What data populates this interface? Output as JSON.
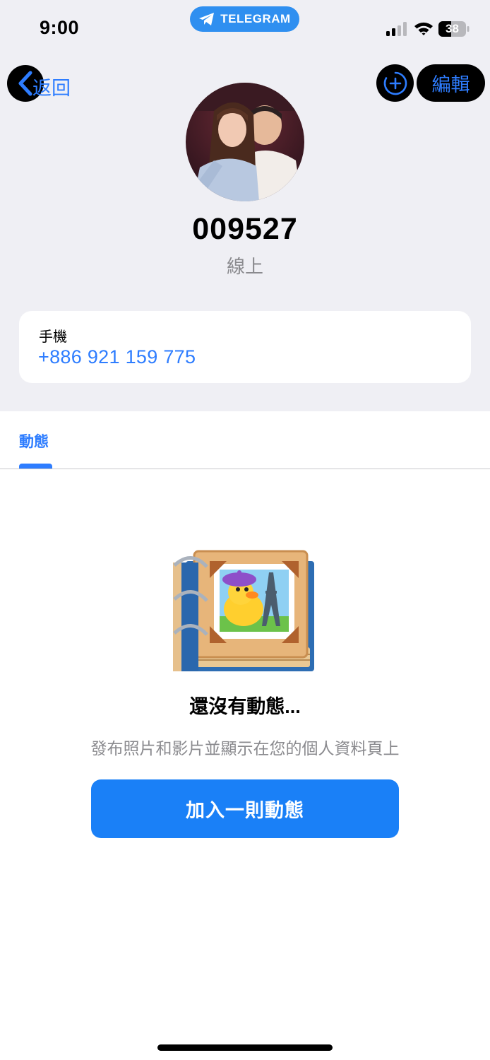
{
  "status_bar": {
    "time": "9:00",
    "app_pill": "TELEGRAM",
    "battery": "38"
  },
  "nav": {
    "back_label": "返回",
    "edit_label": "編輯"
  },
  "profile": {
    "name": "009527",
    "presence": "線上"
  },
  "phone": {
    "label": "手機",
    "value": "+886 921 159 775"
  },
  "tabs": [
    {
      "label": "動態",
      "selected": true
    }
  ],
  "empty_state": {
    "title": "還沒有動態...",
    "subtitle": "發布照片和影片並顯示在您的個人資料頁上",
    "button_label": "加入一則動態"
  },
  "colors": {
    "accent": "#2e7dff",
    "button": "#1a80f7",
    "header_background": "#efeff4"
  }
}
